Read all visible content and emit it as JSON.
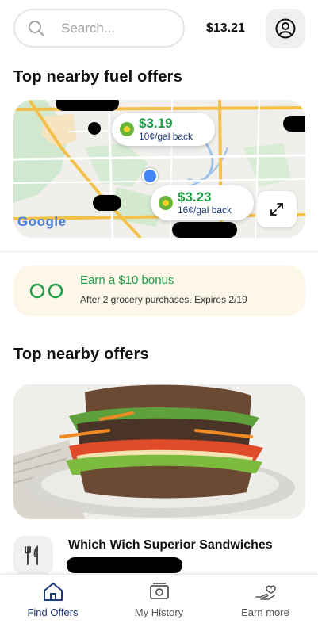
{
  "header": {
    "search_placeholder": "Search...",
    "balance": "$13.21"
  },
  "fuel_section": {
    "title": "Top nearby fuel offers",
    "offers": [
      {
        "price": "$3.19",
        "cashback": "10¢/gal back"
      },
      {
        "price": "$3.23",
        "cashback": "16¢/gal back"
      }
    ],
    "map_attribution": "Google"
  },
  "bonus": {
    "title": "Earn a $10 bonus",
    "subtitle": "After 2 grocery purchases. Expires 2/19"
  },
  "offers_section": {
    "title": "Top nearby offers",
    "merchant_name": "Which Wich Superior Sandwiches"
  },
  "tabs": [
    {
      "label": "Find Offers",
      "icon": "home-icon",
      "active": true
    },
    {
      "label": "My History",
      "icon": "receipt-icon",
      "active": false
    },
    {
      "label": "Earn more",
      "icon": "hand-heart-icon",
      "active": false
    }
  ],
  "colors": {
    "accent_green": "#1fa048",
    "brand_navy": "#1e3a78",
    "bonus_background": "#fdf7e9"
  }
}
